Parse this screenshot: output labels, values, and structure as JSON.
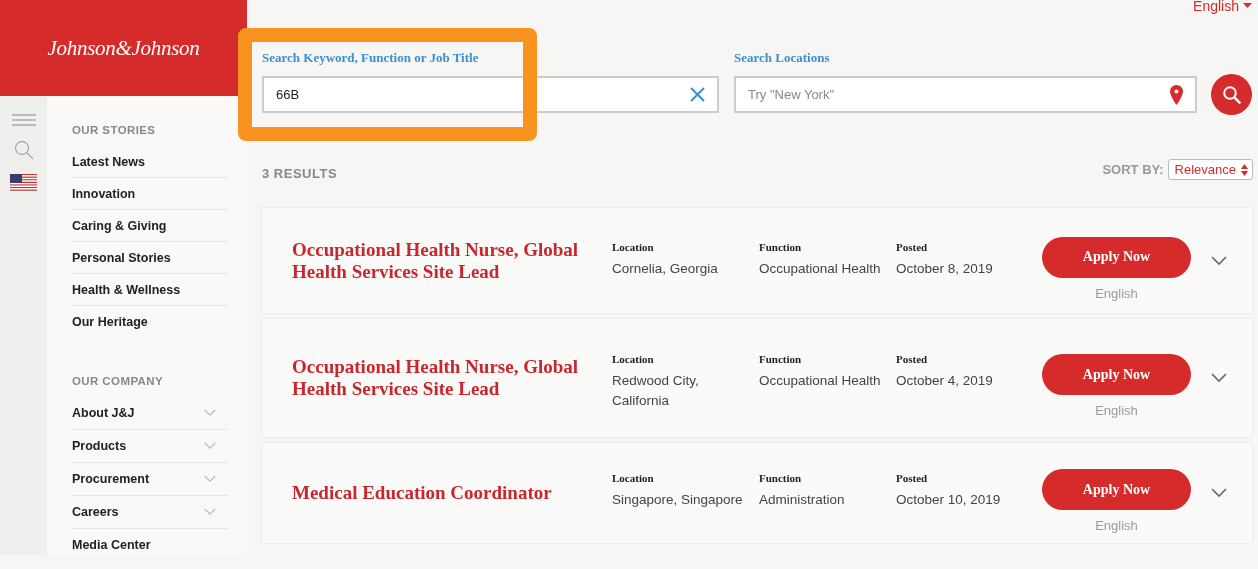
{
  "logo": "Johnson&Johnson",
  "language": "English",
  "sidebar": {
    "sections": [
      {
        "title": "OUR STORIES",
        "items": [
          {
            "label": "Latest News",
            "has_submenu": false
          },
          {
            "label": "Innovation",
            "has_submenu": false
          },
          {
            "label": "Caring & Giving",
            "has_submenu": false
          },
          {
            "label": "Personal Stories",
            "has_submenu": false
          },
          {
            "label": "Health & Wellness",
            "has_submenu": false
          },
          {
            "label": "Our Heritage",
            "has_submenu": false
          }
        ]
      },
      {
        "title": "OUR COMPANY",
        "items": [
          {
            "label": "About J&J",
            "has_submenu": true
          },
          {
            "label": "Products",
            "has_submenu": true
          },
          {
            "label": "Procurement",
            "has_submenu": true
          },
          {
            "label": "Careers",
            "has_submenu": true
          },
          {
            "label": "Media Center",
            "has_submenu": false
          }
        ]
      }
    ]
  },
  "search": {
    "keyword_label": "Search Keyword, Function or Job Title",
    "keyword_value": "66B",
    "keyword_highlighted": true,
    "location_label": "Search Locations",
    "location_placeholder": "Try \"New York\""
  },
  "results_count": "3 RESULTS",
  "sort": {
    "label": "SORT BY:",
    "value": "Relevance"
  },
  "jobs": [
    {
      "title": "Occupational Health Nurse, Global Health Services Site Lead",
      "location_label": "Location",
      "location": "Cornelia, Georgia",
      "function_label": "Function",
      "function": "Occupational Health",
      "posted_label": "Posted",
      "posted": "October 8, 2019",
      "button": "Apply Now",
      "language": "English"
    },
    {
      "title": "Occupational Health Nurse, Global Health Services Site Lead",
      "location_label": "Location",
      "location": "Redwood City, California",
      "function_label": "Function",
      "function": "Occupational Health",
      "posted_label": "Posted",
      "posted": "October 4, 2019",
      "button": "Apply Now",
      "language": "English"
    },
    {
      "title": "Medical Education Coordinator",
      "location_label": "Location",
      "location": "Singapore, Singapore",
      "function_label": "Function",
      "function": "Administration",
      "posted_label": "Posted",
      "posted": "October 10, 2019",
      "button": "Apply Now",
      "language": "English"
    }
  ]
}
